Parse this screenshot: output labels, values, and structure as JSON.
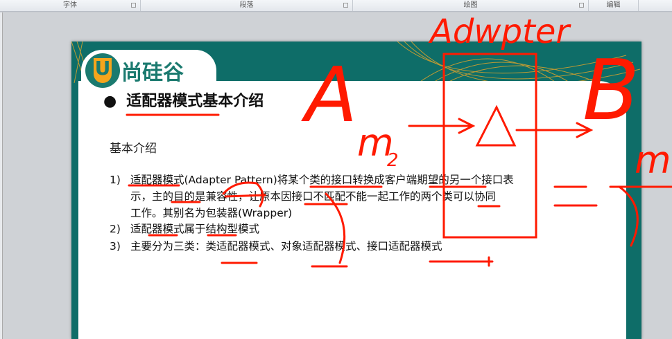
{
  "ribbon": {
    "groups": [
      "字体",
      "段落",
      "绘图",
      "编辑"
    ]
  },
  "slide": {
    "logo_text": "尚硅谷",
    "logo_letter": "U",
    "title": "适配器模式基本介绍",
    "bullet": "●",
    "subhead": "基本介绍",
    "items": [
      {
        "num": "1)",
        "lines": [
          "适配器模式(Adapter Pattern)将某个类的接口转换成客户端期望的另一个接口表",
          "示，主的目的是兼容性，让原本因接口不匹配不能一起工作的两个类可以协同",
          "工作。其别名为包装器(Wrapper)"
        ]
      },
      {
        "num": "2)",
        "lines": [
          "适配器模式属于结构型模式"
        ]
      },
      {
        "num": "3)",
        "lines": [
          "主要分为三类：类适配器模式、对象适配器模式、接口适配器模式"
        ]
      }
    ]
  },
  "annotations": {
    "color": "#ff1a00",
    "adapter": "Adwpter",
    "a": "A",
    "m2": "m",
    "sub2": "2",
    "b": "B",
    "m": "m"
  }
}
